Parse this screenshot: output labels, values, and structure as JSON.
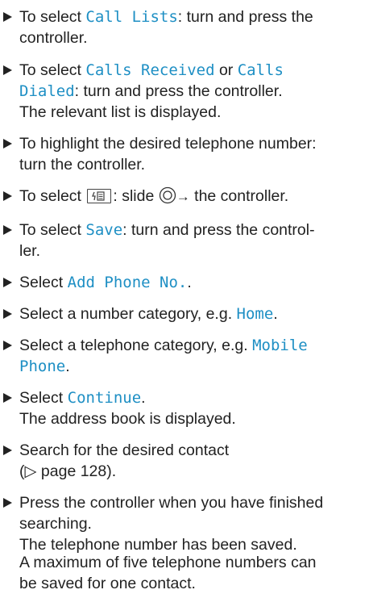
{
  "s1": {
    "a": "To select ",
    "hl": "Call Lists",
    "b": ": turn and press the",
    "c": "controller."
  },
  "s2": {
    "a": "To select ",
    "hl1": "Calls Received",
    "b": " or ",
    "hl2": "Calls",
    "hl3": "Dialed",
    "c": ": turn and press the controller.",
    "result": "The relevant list is displayed."
  },
  "s3": {
    "line1": "To highlight the desired telephone number:",
    "line2": "turn the controller."
  },
  "s4": {
    "a": "To select ",
    "b": ": slide ",
    "arrow": "→",
    "c": " the controller."
  },
  "s5": {
    "a": "To select ",
    "hl": "Save",
    "b": ": turn and press the control-",
    "c": "ler."
  },
  "s6": {
    "a": "Select ",
    "hl": "Add Phone No.",
    "b": "."
  },
  "s7": {
    "a": "Select a number category, e.g. ",
    "hl": "Home",
    "b": "."
  },
  "s8": {
    "a": "Select a telephone category, e.g. ",
    "hl1": "Mobile",
    "hl2": "Phone",
    "b": "."
  },
  "s9": {
    "a": "Select ",
    "hl": "Continue",
    "b": ".",
    "result": "The address book is displayed."
  },
  "s10": {
    "line1": "Search for the desired contact",
    "ref": "(▷ page 128)."
  },
  "s11": {
    "line1": "Press the controller when you have finished",
    "line2": "searching.",
    "result": "The telephone number has been saved."
  },
  "note": {
    "line1": "A maximum of five telephone numbers can",
    "line2": "be saved for one contact."
  }
}
